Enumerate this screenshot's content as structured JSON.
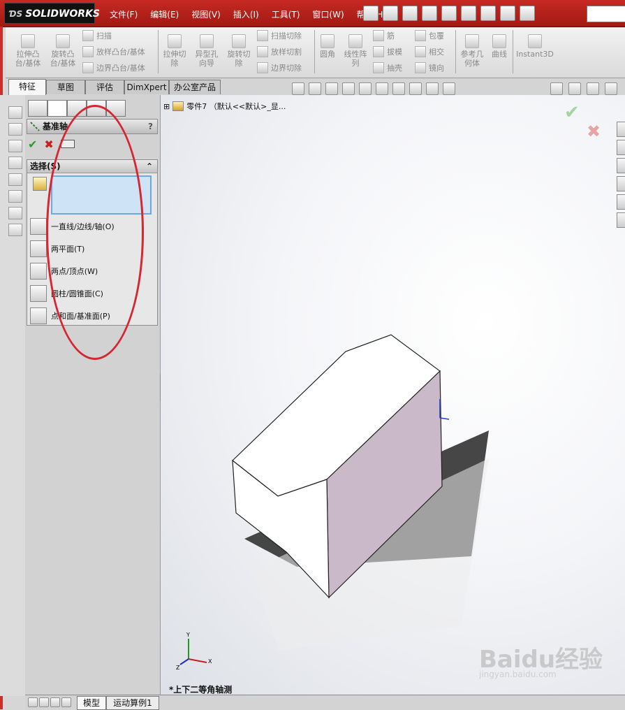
{
  "app": {
    "name": "SOLIDWORKS",
    "brand_color": "#c62a24"
  },
  "menu": [
    "文件(F)",
    "编辑(E)",
    "视图(V)",
    "插入(I)",
    "工具(T)",
    "窗口(W)",
    "帮助(H)"
  ],
  "ribbon": {
    "btn1": [
      "拉伸凸",
      "台/基体"
    ],
    "btn2": [
      "旋转凸",
      "台/基体"
    ],
    "small1": [
      "扫描",
      "放样凸台/基体",
      "边界凸台/基体"
    ],
    "btn3": [
      "拉伸切",
      "除"
    ],
    "btn4": [
      "异型孔",
      "向导"
    ],
    "btn5": [
      "旋转切",
      "除"
    ],
    "small2": [
      "扫描切除",
      "放样切割",
      "边界切除"
    ],
    "btn6": [
      "圆角"
    ],
    "btn7": [
      "线性阵",
      "列"
    ],
    "small3": [
      "筋",
      "拔模",
      "抽壳"
    ],
    "small4": [
      "包覆",
      "相交",
      "镜向"
    ],
    "btn8": [
      "参考几",
      "何体"
    ],
    "btn9": [
      "曲线"
    ],
    "btn10": [
      "Instant3D"
    ]
  },
  "tabs": [
    "特征",
    "草图",
    "评估",
    "DimXpert",
    "办公室产品"
  ],
  "property_manager": {
    "title": "基准轴",
    "help": "?",
    "ok": "✔",
    "cancel": "✖",
    "selection_group": "选择(S)",
    "options": [
      "一直线/边线/轴(O)",
      "两平面(T)",
      "两点/顶点(W)",
      "圆柱/圆锥面(C)",
      "点和面/基准面(P)"
    ]
  },
  "tree": {
    "expand": "⊞",
    "item": "零件7 （默认<<默认>_显..."
  },
  "viewport": {
    "view_name": "*上下二等角轴测",
    "ok": "✔",
    "cancel": "✖",
    "axis_x": "X",
    "axis_y": "Y",
    "axis_z": "Z"
  },
  "bottom_tabs": [
    "模型",
    "运动算例1"
  ],
  "watermark": {
    "main": "Baidu经验",
    "sub": "jingyan.baidu.com"
  }
}
